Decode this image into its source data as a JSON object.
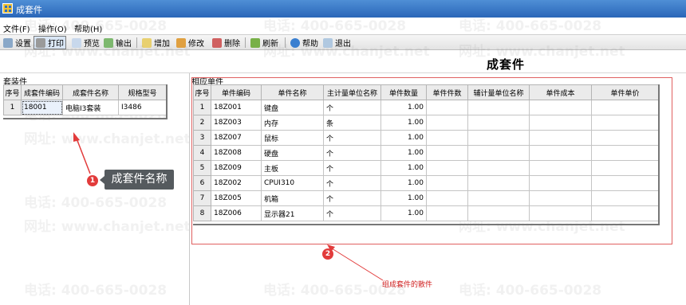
{
  "window": {
    "title": "成套件"
  },
  "menu": [
    {
      "label": "文件(F)"
    },
    {
      "label": "操作(O)"
    },
    {
      "label": "帮助(H)"
    }
  ],
  "toolbar": [
    {
      "label": "设置",
      "icon": "settings-icon"
    },
    {
      "label": "打印",
      "icon": "printer-icon"
    },
    {
      "label": "预览",
      "icon": "preview-icon"
    },
    {
      "label": "输出",
      "icon": "export-icon"
    },
    {
      "label": "增加",
      "icon": "add-icon"
    },
    {
      "label": "修改",
      "icon": "edit-icon"
    },
    {
      "label": "删除",
      "icon": "delete-icon"
    },
    {
      "label": "刷新",
      "icon": "refresh-icon"
    },
    {
      "label": "帮助",
      "icon": "help-icon"
    },
    {
      "label": "退出",
      "icon": "exit-icon"
    }
  ],
  "page_title": "成套件",
  "kit_section": {
    "label": "套装件",
    "columns": [
      "序号",
      "成套件编码",
      "成套件名称",
      "规格型号"
    ],
    "rows": [
      [
        "1",
        "18001",
        "电脑I3套装",
        "I3486"
      ]
    ]
  },
  "parts_section": {
    "label": "相应单件",
    "columns": [
      "序号",
      "单件编码",
      "单件名称",
      "主计量单位名称",
      "单件数量",
      "单件件数",
      "辅计量单位名称",
      "单件成本",
      "单件单价"
    ],
    "rows": [
      [
        "1",
        "18Z001",
        "键盘",
        "个",
        "1.00",
        "",
        "",
        "",
        ""
      ],
      [
        "2",
        "18Z003",
        "内存",
        "条",
        "1.00",
        "",
        "",
        "",
        ""
      ],
      [
        "3",
        "18Z007",
        "鼠标",
        "个",
        "1.00",
        "",
        "",
        "",
        ""
      ],
      [
        "4",
        "18Z008",
        "硬盘",
        "个",
        "1.00",
        "",
        "",
        "",
        ""
      ],
      [
        "5",
        "18Z009",
        "主板",
        "个",
        "1.00",
        "",
        "",
        "",
        ""
      ],
      [
        "6",
        "18Z002",
        "CPUI310",
        "个",
        "1.00",
        "",
        "",
        "",
        ""
      ],
      [
        "7",
        "18Z005",
        "机箱",
        "个",
        "1.00",
        "",
        "",
        "",
        ""
      ],
      [
        "8",
        "18Z006",
        "显示器21",
        "个",
        "1.00",
        "",
        "",
        "",
        ""
      ]
    ]
  },
  "annotations": {
    "badge1": "1",
    "callout1": "成套件名称",
    "badge2": "2",
    "caption2": "组成套件的散件"
  },
  "watermark": {
    "phone": "电话: 400-665-0028",
    "site": "网址: www.chanjet.net"
  },
  "colors": {
    "titlebar": "#2a66b8",
    "annotation_red": "#e23b3b",
    "callout_bg": "#555a5e"
  }
}
